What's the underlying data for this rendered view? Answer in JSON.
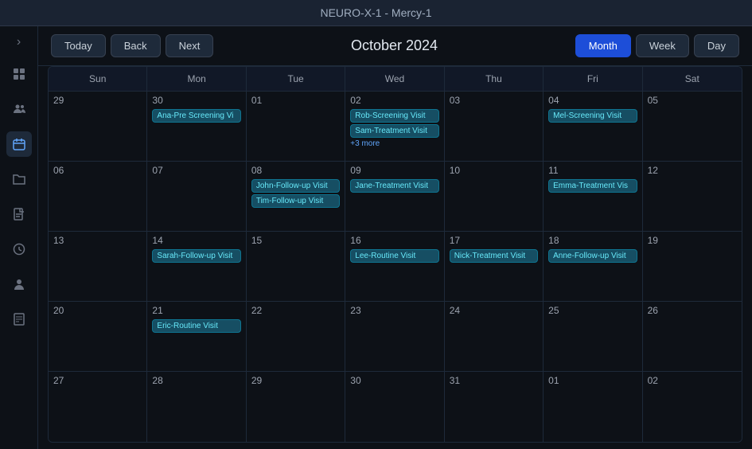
{
  "app": {
    "title": "NEURO-X-1 - Mercy-1"
  },
  "toolbar": {
    "today_label": "Today",
    "back_label": "Back",
    "next_label": "Next",
    "current_period": "October 2024",
    "month_label": "Month",
    "week_label": "Week",
    "day_label": "Day",
    "active_view": "Month"
  },
  "sidebar": {
    "toggle_icon": "›",
    "icons": [
      {
        "name": "grid-icon",
        "symbol": "⊞",
        "active": false
      },
      {
        "name": "users-icon",
        "symbol": "👥",
        "active": false
      },
      {
        "name": "calendar-icon",
        "symbol": "📅",
        "active": true
      },
      {
        "name": "folder-icon",
        "symbol": "📁",
        "active": false
      },
      {
        "name": "document-icon",
        "symbol": "📄",
        "active": false
      },
      {
        "name": "clock-icon",
        "symbol": "🕐",
        "active": false
      },
      {
        "name": "person-icon",
        "symbol": "👤",
        "active": false
      },
      {
        "name": "report-icon",
        "symbol": "📋",
        "active": false
      }
    ]
  },
  "calendar": {
    "headers": [
      "Sun",
      "Mon",
      "Tue",
      "Wed",
      "Thu",
      "Fri",
      "Sat"
    ],
    "weeks": [
      {
        "days": [
          {
            "date": "29",
            "events": []
          },
          {
            "date": "30",
            "events": [
              "Ana-Pre Screening Vi"
            ]
          },
          {
            "date": "01",
            "events": []
          },
          {
            "date": "02",
            "events": [
              "Rob-Screening Visit",
              "Sam-Treatment Visit"
            ],
            "more": "+3 more"
          },
          {
            "date": "03",
            "events": []
          },
          {
            "date": "04",
            "events": [
              "Mel-Screening Visit"
            ]
          },
          {
            "date": "05",
            "events": []
          }
        ]
      },
      {
        "days": [
          {
            "date": "06",
            "events": []
          },
          {
            "date": "07",
            "events": []
          },
          {
            "date": "08",
            "events": [
              "John-Follow-up Visit",
              "Tim-Follow-up Visit"
            ]
          },
          {
            "date": "09",
            "events": [
              "Jane-Treatment Visit"
            ]
          },
          {
            "date": "10",
            "events": []
          },
          {
            "date": "11",
            "events": [
              "Emma-Treatment Vis"
            ]
          },
          {
            "date": "12",
            "events": []
          }
        ]
      },
      {
        "days": [
          {
            "date": "13",
            "events": []
          },
          {
            "date": "14",
            "events": [
              "Sarah-Follow-up Visit"
            ]
          },
          {
            "date": "15",
            "events": []
          },
          {
            "date": "16",
            "events": [
              "Lee-Routine Visit"
            ]
          },
          {
            "date": "17",
            "events": [
              "Nick-Treatment Visit"
            ]
          },
          {
            "date": "18",
            "events": [
              "Anne-Follow-up Visit"
            ]
          },
          {
            "date": "19",
            "events": []
          }
        ]
      },
      {
        "days": [
          {
            "date": "20",
            "events": []
          },
          {
            "date": "21",
            "events": [
              "Eric-Routine Visit"
            ]
          },
          {
            "date": "22",
            "events": []
          },
          {
            "date": "23",
            "events": []
          },
          {
            "date": "24",
            "events": []
          },
          {
            "date": "25",
            "events": []
          },
          {
            "date": "26",
            "events": []
          }
        ]
      },
      {
        "days": [
          {
            "date": "27",
            "events": []
          },
          {
            "date": "28",
            "events": []
          },
          {
            "date": "29",
            "events": []
          },
          {
            "date": "30",
            "events": []
          },
          {
            "date": "31",
            "events": []
          },
          {
            "date": "01",
            "events": []
          },
          {
            "date": "02",
            "events": []
          }
        ]
      }
    ]
  }
}
